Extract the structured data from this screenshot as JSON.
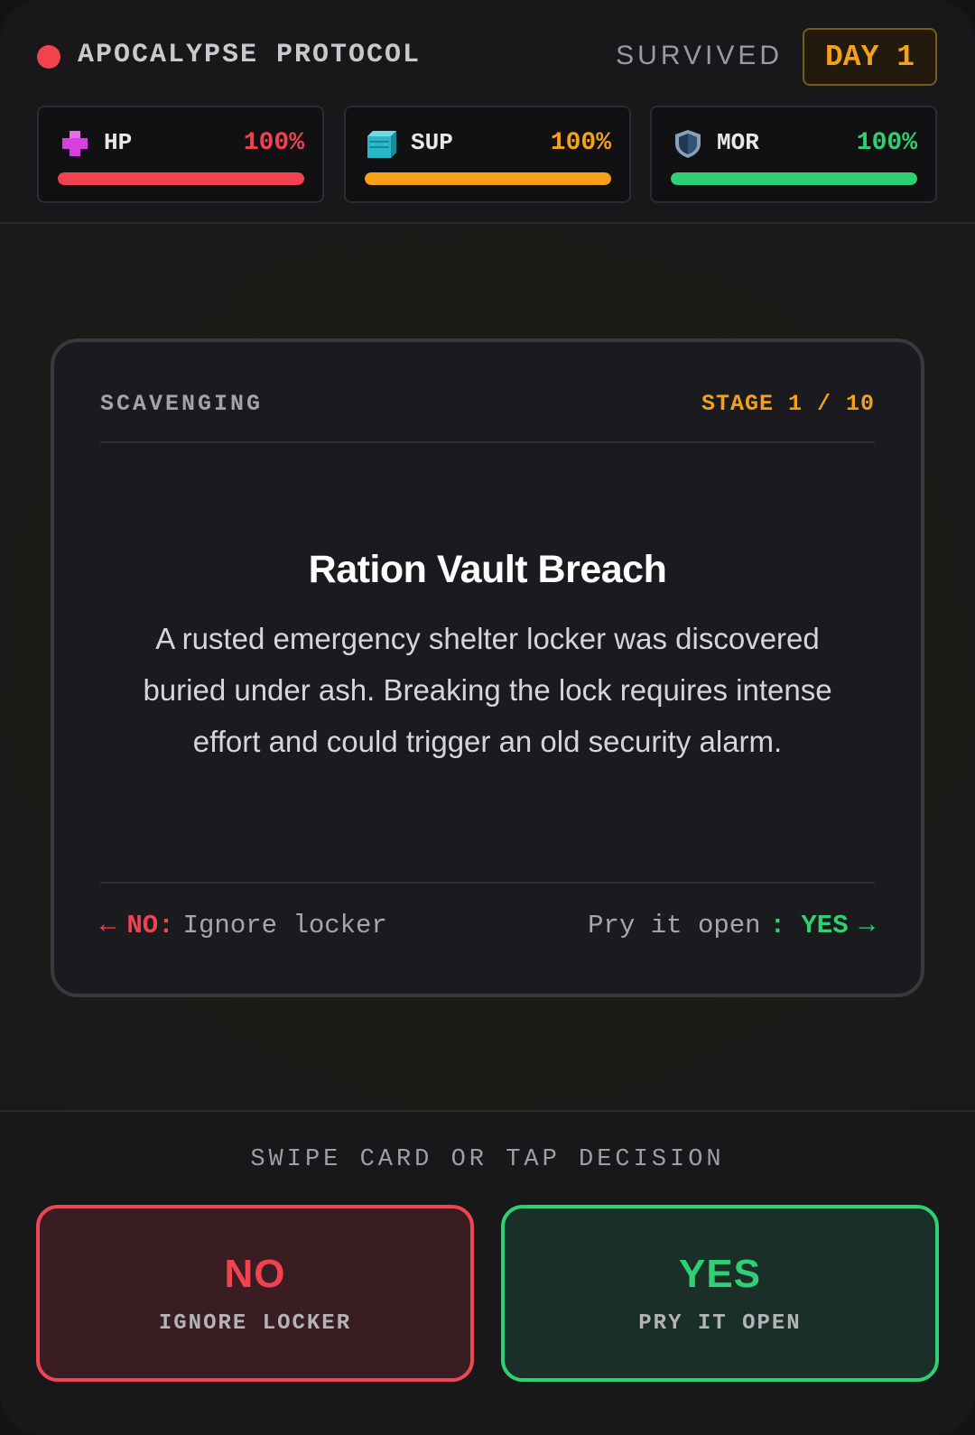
{
  "header": {
    "title": "APOCALYPSE PROTOCOL",
    "survived_label": "SURVIVED",
    "day_label": "DAY 1"
  },
  "stats": [
    {
      "name": "HP",
      "value": 100,
      "display": "100%",
      "color": "#f0434f",
      "icon": "medical-cross-icon"
    },
    {
      "name": "SUP",
      "value": 100,
      "display": "100%",
      "color": "#f7a11a",
      "icon": "supply-crate-icon"
    },
    {
      "name": "MOR",
      "value": 100,
      "display": "100%",
      "color": "#2fcf74",
      "icon": "shield-icon"
    }
  ],
  "card": {
    "category": "SCAVENGING",
    "stage": "STAGE 1 / 10",
    "title": "Ration Vault Breach",
    "description": "A rusted emergency shelter locker was discovered buried under ash. Breaking the lock requires intense effort and could trigger an old security alarm.",
    "left_arrow": "←",
    "no_tag": "NO:",
    "no_hint": "Ignore locker",
    "yes_hint": "Pry it open",
    "yes_tag": ": YES",
    "right_arrow": "→"
  },
  "footer": {
    "swipe_hint": "SWIPE CARD OR TAP DECISION",
    "no_button": {
      "label": "NO",
      "sub": "IGNORE LOCKER"
    },
    "yes_button": {
      "label": "YES",
      "sub": "PRY IT OPEN"
    }
  }
}
